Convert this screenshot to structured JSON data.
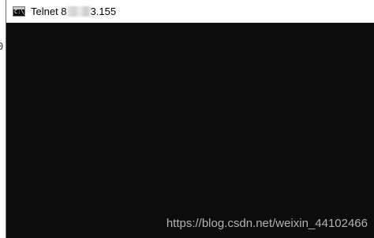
{
  "background_window": {
    "glyph": "0"
  },
  "window": {
    "title_prefix": "Telnet 8",
    "title_suffix": "3.155",
    "icon": "console-icon",
    "icon_prompt": "C:\\_"
  },
  "console": {
    "background_color": "#0c0c0c"
  },
  "watermark": {
    "text": "https://blog.csdn.net/weixin_44102466"
  }
}
